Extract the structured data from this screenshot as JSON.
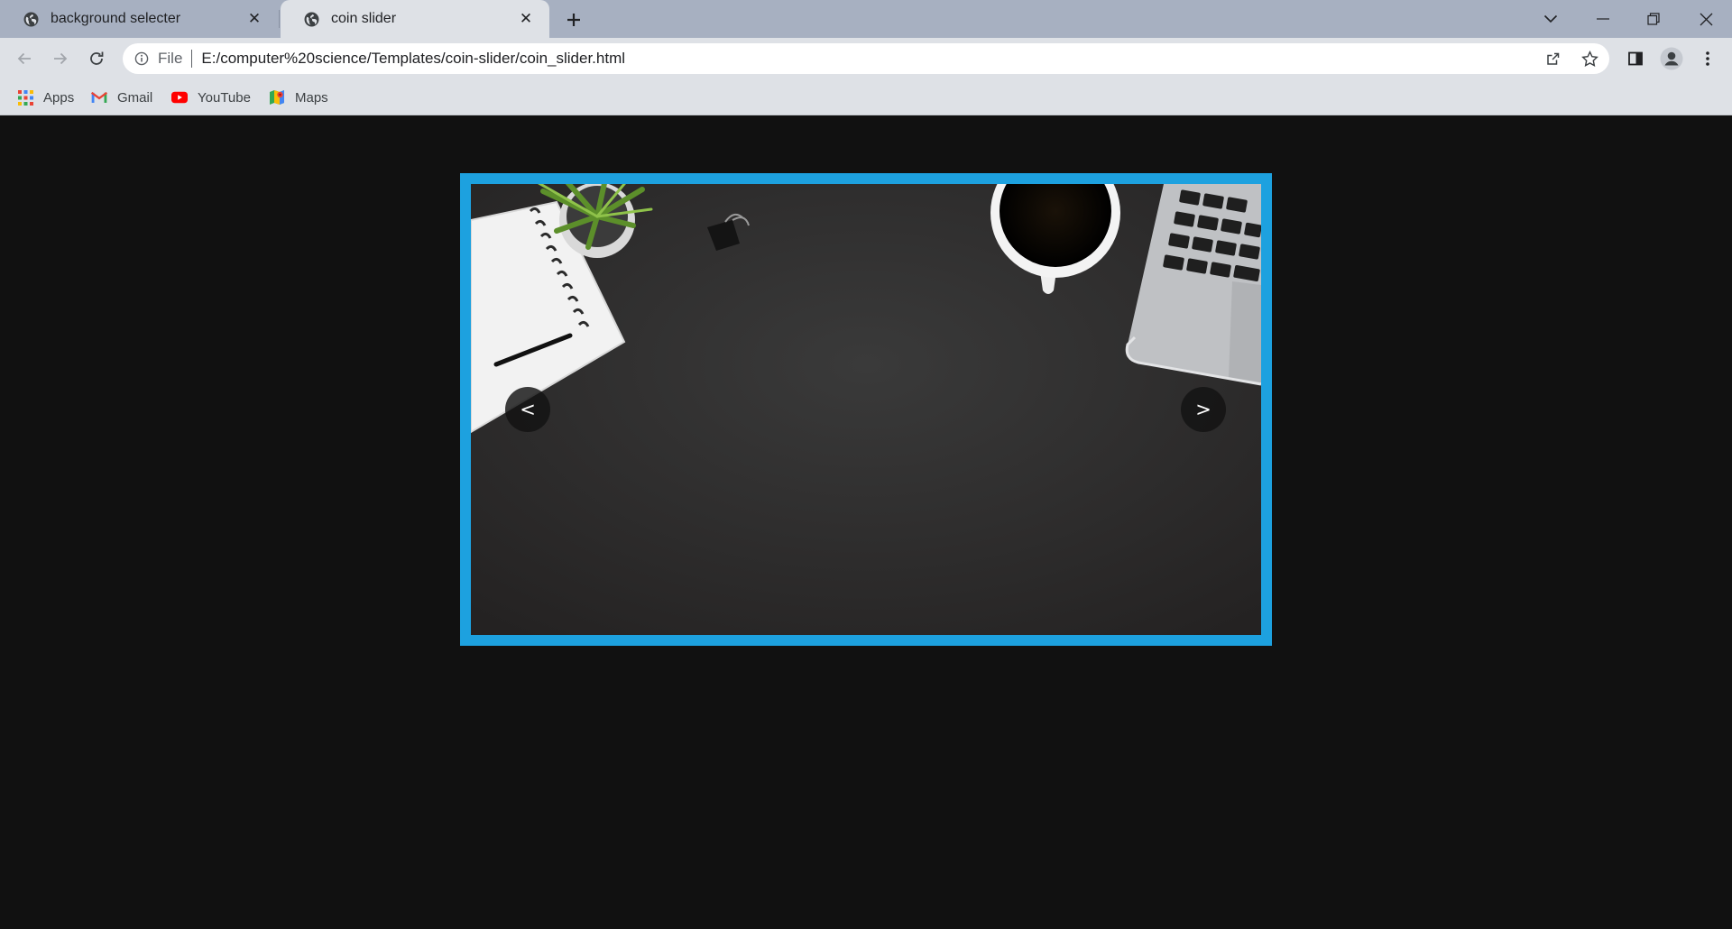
{
  "browser": {
    "tabs": [
      {
        "title": "background selecter",
        "active": false
      },
      {
        "title": "coin slider",
        "active": true
      }
    ],
    "address_bar": {
      "scheme_label": "File",
      "url": "E:/computer%20science/Templates/coin-slider/coin_slider.html"
    },
    "bookmarks": [
      {
        "label": "Apps",
        "icon": "apps-grid-icon"
      },
      {
        "label": "Gmail",
        "icon": "gmail-icon"
      },
      {
        "label": "YouTube",
        "icon": "youtube-icon"
      },
      {
        "label": "Maps",
        "icon": "maps-icon"
      }
    ]
  },
  "slider": {
    "border_color": "#1da1df",
    "prev_label": "<",
    "next_label": ">"
  }
}
